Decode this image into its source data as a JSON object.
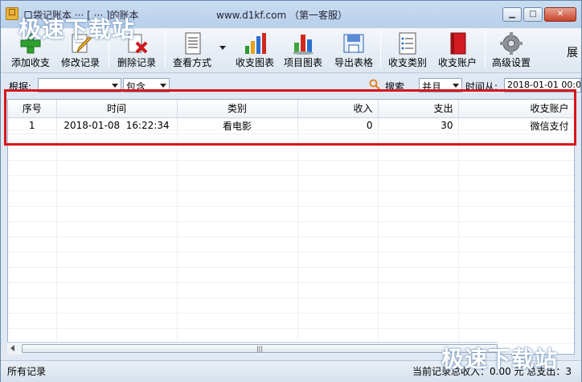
{
  "window": {
    "title_left": "口袋记账本 ··· [ ··· ]的账本",
    "title_center": "www.d1kf.com （第一客服）",
    "watermark": "极速下载站",
    "minimize": "▁",
    "maximize": "□",
    "close": "✕"
  },
  "toolbar": {
    "items": [
      {
        "label": "添加收支",
        "icon": "add-plus-icon"
      },
      {
        "label": "修改记录",
        "icon": "edit-pencil-icon"
      },
      {
        "label": "删除记录",
        "icon": "delete-x-icon"
      },
      {
        "label": "查看方式",
        "icon": "view-document-icon"
      },
      {
        "label": "收支图表",
        "icon": "bar-chart-icon"
      },
      {
        "label": "项目图表",
        "icon": "project-chart-icon"
      },
      {
        "label": "导出表格",
        "icon": "export-table-icon"
      },
      {
        "label": "收支类别",
        "icon": "category-list-icon"
      },
      {
        "label": "收支账户",
        "icon": "account-book-icon"
      },
      {
        "label": "高级设置",
        "icon": "gear-icon"
      }
    ],
    "overflow_label": "展"
  },
  "filter": {
    "basis_label": "根据:",
    "basis_value": "",
    "match_value": "包含",
    "search_label": "搜索",
    "logic_value": "并且",
    "time_from_label": "时间从:",
    "time_from_value": "2018-01-01 00:0"
  },
  "table": {
    "columns": [
      "序号",
      "时间",
      "类别",
      "收入",
      "支出",
      "收支账户"
    ],
    "rows": [
      {
        "seq": "1",
        "time": "2018-01-08  16:22:34",
        "category": "看电影",
        "income": "0",
        "expense": "30",
        "account": "微信支付"
      }
    ]
  },
  "scrollbar": {
    "thumb_grip": "|||"
  },
  "status": {
    "left": "所有记录",
    "right": "当前记录总收入：0.00 元  总支出：3"
  },
  "colors": {
    "highlight_border": "#d7141a",
    "window_bg": "#dfe8f3"
  }
}
